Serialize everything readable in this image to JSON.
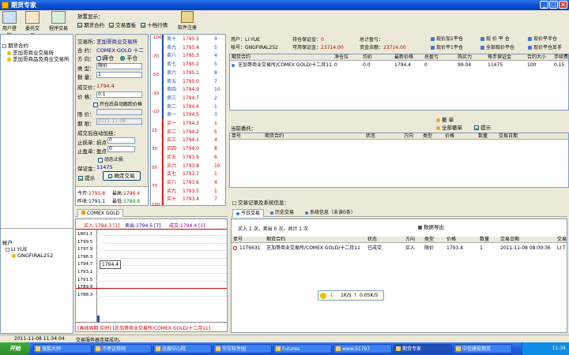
{
  "window": {
    "title": "期货专家"
  },
  "toolbar": {
    "items": [
      {
        "label": "用户登陆"
      },
      {
        "label": "委托交易"
      },
      {
        "label": "程序交易"
      }
    ]
  },
  "tree": {
    "root_label": "期货合约",
    "items": [
      "芝加哥商业交易所",
      "芝加哥商品及商业交易所"
    ],
    "accounts_label": "帐户",
    "user": "LI YUE",
    "account_id": "GNGFIRAL252"
  },
  "options": {
    "label": "放置显示：",
    "check1": "期货合约",
    "check2": "交易面板",
    "check3": "十档行情",
    "register_label": "软件注册"
  },
  "order": {
    "exchange_label": "交易所：",
    "exchange": "芝加哥商业交易所",
    "contract_label": "合 约：",
    "contract": "COMEX GOLD 十二月11",
    "direction_label": "方 向：",
    "open_label": "开仓",
    "close_label": "平仓",
    "type_label": "类 型：",
    "type_value": "限价",
    "qty_label": "数 量：",
    "qty_value": "1",
    "deal_label": "成交价：",
    "deal_value": "1794.4",
    "price_label": "价 格：",
    "price_value": "0.1",
    "chase_label": "开仓后自动跟踪价格",
    "trigger_label": "限 价：",
    "deadline_label": "期 限：",
    "deadline_value": "2011-11-08",
    "auto_label": "成交后自动加挂：",
    "stoploss_label": "止损单：",
    "stoploss_unit": "损点",
    "stoploss_val": "0",
    "takeprofit_label": "止盈单：",
    "takeprofit_unit": "盈点",
    "takeprofit_val": "0",
    "dynamic_label": "动态止损",
    "margin_label": "保证金：",
    "margin_value": "11475",
    "confirm_label": "提示",
    "submit_label": "确定交易",
    "open_today_label": "今开:",
    "open_today": "1795.8",
    "high_label": "最高:",
    "high": "1796.4",
    "prev_close_label": "昨收:",
    "prev_close": "1791.1",
    "low_label": "最低:",
    "low": "1789.8"
  },
  "ladder": {
    "axis": [
      "-100",
      "-70",
      "-50",
      "-30",
      "-10",
      "10",
      "30",
      "50",
      "70",
      "100"
    ],
    "asks": [
      {
        "label": "卖十",
        "price": "1795.5",
        "vol": "9"
      },
      {
        "label": "卖九",
        "price": "1795.4",
        "vol": "5"
      },
      {
        "label": "卖八",
        "price": "1795.3",
        "vol": "4"
      },
      {
        "label": "卖七",
        "price": "1795.2",
        "vol": "5"
      },
      {
        "label": "卖六",
        "price": "1795.1",
        "vol": "8"
      },
      {
        "label": "卖五",
        "price": "1795.0",
        "vol": "7"
      },
      {
        "label": "卖四",
        "price": "1794.9",
        "vol": "10"
      },
      {
        "label": "卖三",
        "price": "1794.7",
        "vol": "2"
      },
      {
        "label": "卖二",
        "price": "1794.6",
        "vol": "1"
      },
      {
        "label": "卖一",
        "price": "1794.5",
        "vol": "3"
      }
    ],
    "bids": [
      {
        "label": "买一",
        "price": "1794.3",
        "vol": "1"
      },
      {
        "label": "买二",
        "price": "1794.2",
        "vol": "5"
      },
      {
        "label": "买三",
        "price": "1794.1",
        "vol": "4"
      },
      {
        "label": "买四",
        "price": "1794.0",
        "vol": "8"
      },
      {
        "label": "买五",
        "price": "1793.9",
        "vol": "6"
      },
      {
        "label": "买六",
        "price": "1793.8",
        "vol": "10"
      },
      {
        "label": "买七",
        "price": "1793.7",
        "vol": "1"
      },
      {
        "label": "买八",
        "price": "1793.6",
        "vol": "4"
      },
      {
        "label": "买九",
        "price": "1793.5",
        "vol": "1"
      },
      {
        "label": "买十",
        "price": "1793.4",
        "vol": "7"
      }
    ]
  },
  "chart": {
    "tab": "COMEX GOLD",
    "buy_label": "买入:",
    "buy_price": "1794.3",
    "buy_vol": "[1]",
    "sell_label": "卖出:",
    "sell_price": "1794.5",
    "sell_vol": "[7]",
    "deal_label": "成交:",
    "deal_price": "1794.4",
    "deal_vol": "[1]",
    "ticks": [
      "1801.1",
      "1799.5",
      "1797.9",
      "1796.3",
      "1794.7",
      "1793.1",
      "1791.5",
      "1789.9",
      "1788.3"
    ],
    "marker": "1794.4",
    "footer": "[画线周期 实时] [芝加哥商业交易所/COMEX GOLD/十二月11]"
  },
  "account": {
    "user_label": "用户：",
    "user": "LI YUE",
    "acct_label": "帐号：",
    "acct": "GNGFIRAL252",
    "hold_margin_label": "持仓保证金：",
    "hold_margin": "0",
    "avail_margin_label": "可用保证金：",
    "avail_margin": "23714.00",
    "total_pnl_label": "总计盈亏：",
    "total_pnl": "",
    "equity_label": "资金余额：",
    "equity": "23714.00",
    "buttons": [
      "现价加1平仓",
      "现 价 平 仓",
      "现价平半仓",
      "现价平1平仓",
      "全部现价平仓",
      "现价平仓反手"
    ]
  },
  "positions": {
    "headers": [
      "期货合约",
      "净仓位",
      "均价",
      "最新价格",
      "总盈亏",
      "购买力",
      "每手保证金",
      "合约大小",
      "手续费"
    ],
    "rows": [
      {
        "contract": "芝加哥商业交易所/COMEX GOLD/十二月11",
        "net": "0",
        "avg": "0.0",
        "last": "1794.4",
        "pnl": "0",
        "power": "99.04",
        "margin": "11475",
        "size": "100",
        "fee": "0.15"
      }
    ]
  },
  "pending": {
    "title": "当前委托：",
    "cancel_label": "撤 单",
    "cancel_all_label": "全部撤单",
    "confirm_label": "提示",
    "headers": [
      "单号",
      "期货合约",
      "状态",
      "方向",
      "类型",
      "价格",
      "数量",
      "交易日期"
    ]
  },
  "history": {
    "section_label": "交易记录及系统信息：",
    "tabs": [
      "今日交易",
      "历史交易",
      "系统信息（未读0条）"
    ],
    "export_label": "数据导出",
    "summary": "买入 1 次，卖出 0 次，共计 1 次",
    "headers": [
      "单号",
      "期货合约",
      "状态",
      "方向",
      "类型",
      "价格",
      "数量",
      "交易日期",
      "交易"
    ],
    "rows": [
      {
        "id": "11T6631",
        "contract": "芝加哥商业交易所/COMEX GOLD/十二月11",
        "status": "已成交",
        "dir": "买入",
        "type": "限价",
        "price": "1793.4",
        "qty": "1",
        "date": "2011-11-08 08:09:36",
        "trader": "LI T"
      }
    ]
  },
  "netspeed": {
    "down": "1K/S",
    "up": "0.05K/S"
  },
  "status": {
    "time": "2011-11-08 11:34:04",
    "msg": "交易服务器连接成功。"
  },
  "taskbar": {
    "start": "开始",
    "tasks": [
      "搜狐大师",
      "不停证券网",
      "迅搜中心院",
      "华军软件园",
      "Futures",
      "www.51797",
      "期货专家",
      "中信建投期货"
    ],
    "clock": "11:34"
  }
}
